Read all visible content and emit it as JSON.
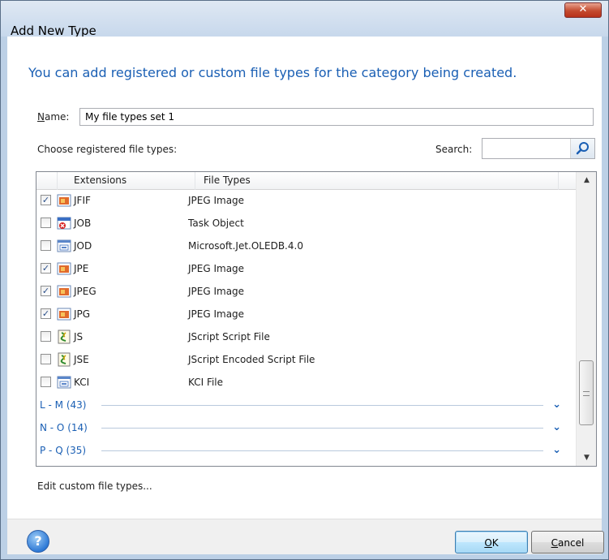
{
  "window": {
    "title": "Add New Type",
    "close_glyph": "✕"
  },
  "instruction": "You can add registered or custom file types for the category being created.",
  "name_field": {
    "label_prefix": "N",
    "label_rest": "ame:",
    "value": "My file types set 1"
  },
  "choose_label": "Choose registered file types:",
  "search": {
    "label": "Search:",
    "placeholder": "",
    "icon": "search-icon"
  },
  "list": {
    "columns": [
      "Extensions",
      "File Types"
    ],
    "rows": [
      {
        "checked": true,
        "ext": "JFIF",
        "type": "JPEG Image",
        "icon": "jpeg-image-icon"
      },
      {
        "checked": false,
        "ext": "JOB",
        "type": "Task Object",
        "icon": "task-object-icon"
      },
      {
        "checked": false,
        "ext": "JOD",
        "type": "Microsoft.Jet.OLEDB.4.0",
        "icon": "generic-app-icon"
      },
      {
        "checked": true,
        "ext": "JPE",
        "type": "JPEG Image",
        "icon": "jpeg-image-icon"
      },
      {
        "checked": true,
        "ext": "JPEG",
        "type": "JPEG Image",
        "icon": "jpeg-image-icon"
      },
      {
        "checked": true,
        "ext": "JPG",
        "type": "JPEG Image",
        "icon": "jpeg-image-icon"
      },
      {
        "checked": false,
        "ext": "JS",
        "type": "JScript Script File",
        "icon": "script-file-icon"
      },
      {
        "checked": false,
        "ext": "JSE",
        "type": "JScript Encoded Script File",
        "icon": "script-file-icon"
      },
      {
        "checked": false,
        "ext": "KCI",
        "type": "KCI File",
        "icon": "generic-app-icon"
      }
    ],
    "groups": [
      {
        "label": "L - M (43)"
      },
      {
        "label": "N - O (14)"
      },
      {
        "label": "P - Q (35)"
      }
    ],
    "check_glyph": "✓",
    "chevron_glyph": "⌄"
  },
  "edit_link": "Edit custom file types...",
  "footer": {
    "help_glyph": "?",
    "ok_prefix": "O",
    "ok_rest": "K",
    "cancel_prefix": "C",
    "cancel_rest": "ancel"
  },
  "colors": {
    "accent": "#1a5fb4",
    "frame": "#bcd0e6",
    "close": "#c44b2f"
  }
}
